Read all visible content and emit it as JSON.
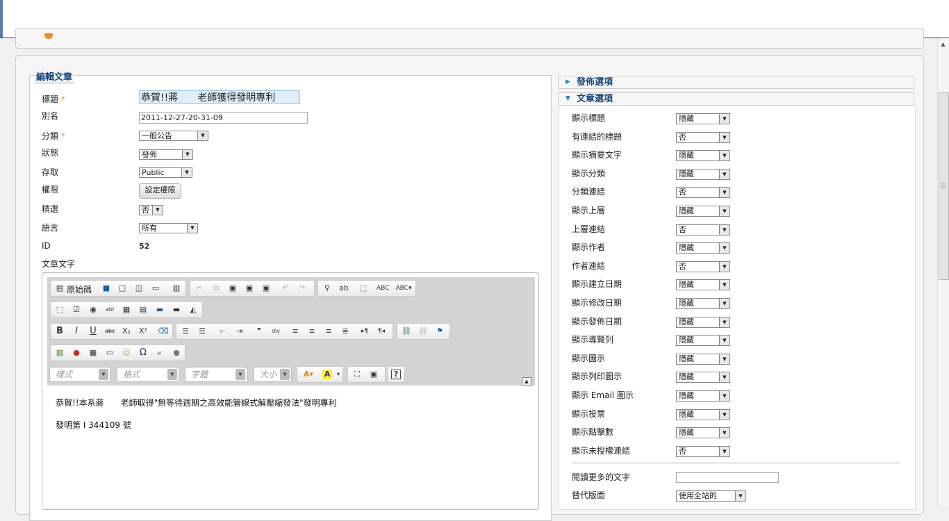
{
  "form": {
    "legend": "編輯文章",
    "required_mark": "*",
    "fields": {
      "title": {
        "label": "標題",
        "value": "恭賀!!蔣　　老師獲得發明專利"
      },
      "alias": {
        "label": "別名",
        "value": "2011-12-27-20-31-09"
      },
      "category": {
        "label": "分類",
        "value": "一般公告"
      },
      "state": {
        "label": "狀態",
        "value": "發佈"
      },
      "access": {
        "label": "存取",
        "value": "Public"
      },
      "permissions": {
        "label": "權限",
        "button": "設定權限"
      },
      "featured": {
        "label": "精選",
        "value": "否"
      },
      "language": {
        "label": "語言",
        "value": "所有"
      },
      "id": {
        "label": "ID",
        "value": "52"
      },
      "article_text": {
        "label": "文章文字"
      }
    }
  },
  "editor": {
    "source_button": "原始碼",
    "combos": {
      "styles": "樣式",
      "format": "格式",
      "font": "字體",
      "size": "大小"
    },
    "content": {
      "line1": "恭賀!!本系蔣　　老師取得\"無等待週期之高效能管線式解壓縮發法\"發明專利",
      "line2": "發明第 I 344109 號"
    }
  },
  "right_panel": {
    "publish_options": {
      "title": "發佈選項",
      "expanded": false
    },
    "article_options": {
      "title": "文章選項",
      "expanded": true
    },
    "options": [
      {
        "label": "顯示標題",
        "value": "隱藏"
      },
      {
        "label": "有連結的標題",
        "value": "否"
      },
      {
        "label": "顯示摘要文字",
        "value": "隱藏"
      },
      {
        "label": "顯示分類",
        "value": "隱藏"
      },
      {
        "label": "分類連結",
        "value": "否"
      },
      {
        "label": "顯示上層",
        "value": "隱藏"
      },
      {
        "label": "上層連結",
        "value": "否"
      },
      {
        "label": "顯示作者",
        "value": "隱藏"
      },
      {
        "label": "作者連結",
        "value": "否"
      },
      {
        "label": "顯示建立日期",
        "value": "隱藏"
      },
      {
        "label": "顯示修改日期",
        "value": "隱藏"
      },
      {
        "label": "顯示發佈日期",
        "value": "隱藏"
      },
      {
        "label": "顯示導覽列",
        "value": "隱藏"
      },
      {
        "label": "顯示圖示",
        "value": "隱藏"
      },
      {
        "label": "顯示列印圖示",
        "value": "隱藏"
      },
      {
        "label": "顯示 Email 圖示",
        "value": "隱藏"
      },
      {
        "label": "顯示投票",
        "value": "隱藏"
      },
      {
        "label": "顯示點擊數",
        "value": "隱藏"
      },
      {
        "label": "顯示未授權連結",
        "value": "否"
      }
    ],
    "read_more": {
      "label": "閱讀更多的文字",
      "value": ""
    },
    "alt_layout": {
      "label": "替代版面",
      "value": "使用全站的"
    }
  },
  "icons": {
    "dropdown_arrow": "▼",
    "collapsed_triangle": "▶",
    "expanded_triangle": "▼",
    "collapse_up": "▲"
  }
}
